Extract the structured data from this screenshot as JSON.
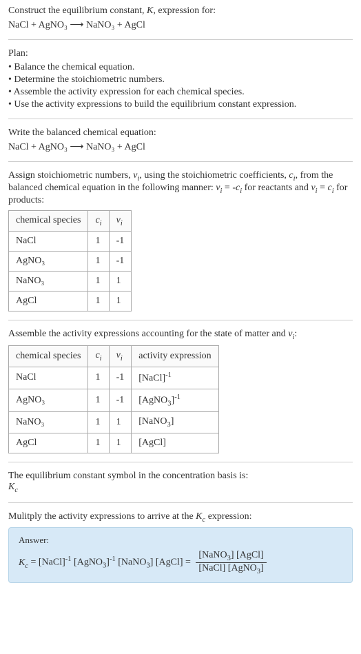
{
  "header": {
    "intro": "Construct the equilibrium constant, K, expression for:",
    "equation": "NaCl + AgNO₃  ⟶  NaNO₃ + AgCl"
  },
  "plan": {
    "title": "Plan:",
    "items": [
      "Balance the chemical equation.",
      "Determine the stoichiometric numbers.",
      "Assemble the activity expression for each chemical species.",
      "Use the activity expressions to build the equilibrium constant expression."
    ]
  },
  "balanced": {
    "title": "Write the balanced chemical equation:",
    "equation": "NaCl + AgNO₃  ⟶  NaNO₃ + AgCl"
  },
  "stoich": {
    "intro1": "Assign stoichiometric numbers, νᵢ, using the stoichiometric coefficients, cᵢ, from the balanced chemical equation in the following manner: νᵢ = -cᵢ for reactants and νᵢ = cᵢ for products:",
    "headers": [
      "chemical species",
      "cᵢ",
      "νᵢ"
    ],
    "rows": [
      [
        "NaCl",
        "1",
        "-1"
      ],
      [
        "AgNO₃",
        "1",
        "-1"
      ],
      [
        "NaNO₃",
        "1",
        "1"
      ],
      [
        "AgCl",
        "1",
        "1"
      ]
    ]
  },
  "activity": {
    "intro": "Assemble the activity expressions accounting for the state of matter and νᵢ:",
    "headers": [
      "chemical species",
      "cᵢ",
      "νᵢ",
      "activity expression"
    ],
    "rows": [
      [
        "NaCl",
        "1",
        "-1",
        "[NaCl]⁻¹"
      ],
      [
        "AgNO₃",
        "1",
        "-1",
        "[AgNO₃]⁻¹"
      ],
      [
        "NaNO₃",
        "1",
        "1",
        "[NaNO₃]"
      ],
      [
        "AgCl",
        "1",
        "1",
        "[AgCl]"
      ]
    ]
  },
  "basis": {
    "line1": "The equilibrium constant symbol in the concentration basis is:",
    "line2": "K_c"
  },
  "multiply": {
    "title": "Mulitply the activity expressions to arrive at the K_c expression:"
  },
  "answer": {
    "label": "Answer:",
    "lhs": "K_c = [NaCl]⁻¹ [AgNO₃]⁻¹ [NaNO₃] [AgCl] =",
    "frac_num": "[NaNO₃] [AgCl]",
    "frac_den": "[NaCl] [AgNO₃]"
  },
  "chart_data": {
    "type": "table",
    "tables": [
      {
        "title": "Stoichiometric numbers",
        "columns": [
          "chemical species",
          "c_i",
          "v_i"
        ],
        "rows": [
          {
            "chemical species": "NaCl",
            "c_i": 1,
            "v_i": -1
          },
          {
            "chemical species": "AgNO3",
            "c_i": 1,
            "v_i": -1
          },
          {
            "chemical species": "NaNO3",
            "c_i": 1,
            "v_i": 1
          },
          {
            "chemical species": "AgCl",
            "c_i": 1,
            "v_i": 1
          }
        ]
      },
      {
        "title": "Activity expressions",
        "columns": [
          "chemical species",
          "c_i",
          "v_i",
          "activity expression"
        ],
        "rows": [
          {
            "chemical species": "NaCl",
            "c_i": 1,
            "v_i": -1,
            "activity expression": "[NaCl]^-1"
          },
          {
            "chemical species": "AgNO3",
            "c_i": 1,
            "v_i": -1,
            "activity expression": "[AgNO3]^-1"
          },
          {
            "chemical species": "NaNO3",
            "c_i": 1,
            "v_i": 1,
            "activity expression": "[NaNO3]"
          },
          {
            "chemical species": "AgCl",
            "c_i": 1,
            "v_i": 1,
            "activity expression": "[AgCl]"
          }
        ]
      }
    ],
    "equilibrium_constant": "K_c = ([NaNO3][AgCl]) / ([NaCl][AgNO3])"
  }
}
